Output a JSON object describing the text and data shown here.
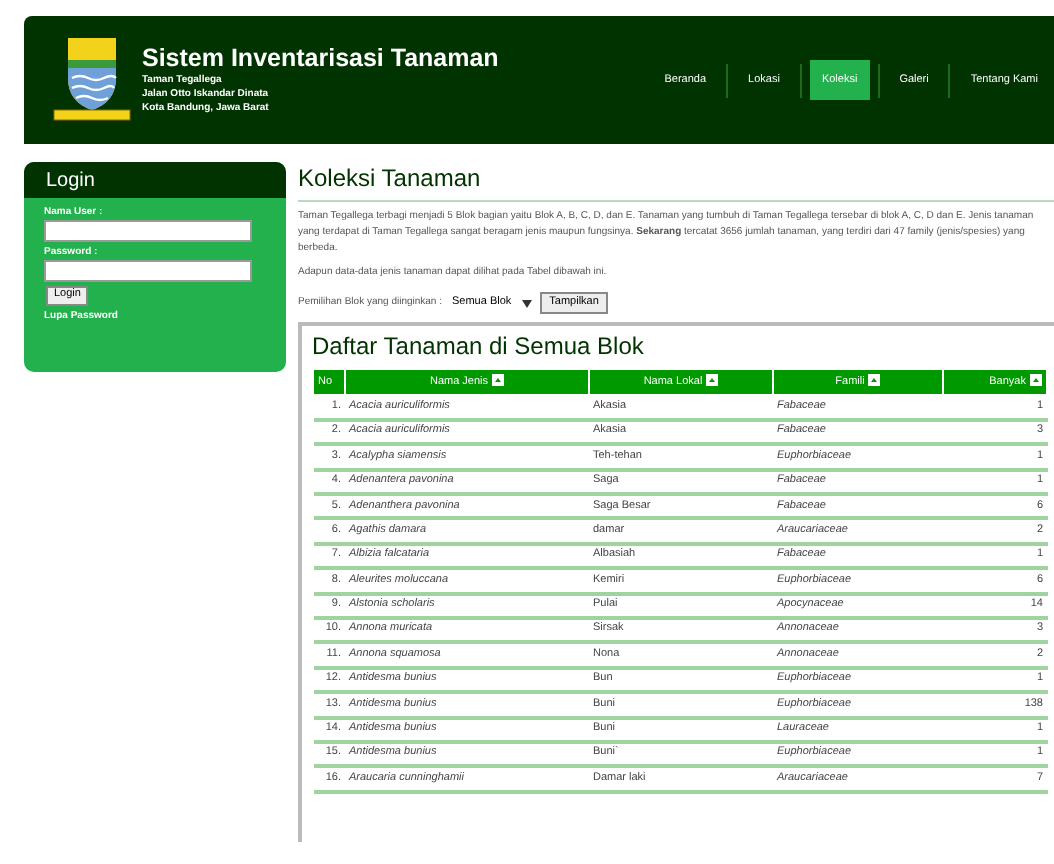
{
  "header": {
    "title": "Sistem Inventarisasi Tanaman",
    "address": [
      "Taman Tegallega",
      "Jalan Otto Iskandar Dinata",
      "Kota Bandung, Jawa Barat"
    ]
  },
  "nav": [
    {
      "label": "Beranda",
      "selected": false
    },
    {
      "label": "Lokasi",
      "selected": false
    },
    {
      "label": "Koleksi",
      "selected": true
    },
    {
      "label": "Galeri",
      "selected": false
    },
    {
      "label": "Tentang Kami",
      "selected": false
    }
  ],
  "login": {
    "title": "Login",
    "username_label": "Nama User :",
    "password_label": "Password :",
    "button": "Login",
    "forgot_link": "Lupa Password"
  },
  "content": {
    "title": "Koleksi Tanaman",
    "paragraph": "Taman Tegallega terbagi menjadi 5 Blok bagian yaitu Blok A, B, C, D, dan E. Tanaman yang tumbuh di Taman Tegallega tersebar di blok A, C, D dan E. Jenis tanaman yang terdapat di Taman Tegallega sangat beragam jenis maupun fungsinya. **Sekarang** tercatat 3656 jumlah tanaman, yang terdiri dari 47 family (jenis/spesies) yang berbeda.",
    "note": "Adapun data-data jenis tanaman dapat dilihat pada Tabel dibawah ini.",
    "filter_label": "Pemilihan Blok yang diinginkan :",
    "filter_value": "Semua Blok",
    "filter_button": "Tampilkan"
  },
  "table": {
    "title": "Daftar Tanaman di Semua Blok",
    "columns": [
      {
        "label": "No",
        "sortable": false
      },
      {
        "label": "Nama Jenis",
        "sortable": true
      },
      {
        "label": "Nama Lokal",
        "sortable": true
      },
      {
        "label": "Famili",
        "sortable": true
      },
      {
        "label": "Banyak",
        "sortable": true
      }
    ],
    "rows": [
      [
        "1.",
        "Acacia auriculiformis",
        "Akasia",
        "Fabaceae",
        "1"
      ],
      [
        "2.",
        "Acacia auriculiformis",
        "Akasia",
        "Fabaceae",
        "3"
      ],
      [
        "3.",
        "Acalypha siamensis",
        "Teh-tehan",
        "Euphorbiaceae",
        "1"
      ],
      [
        "4.",
        "Adenantera pavonina",
        "Saga",
        "Fabaceae",
        "1"
      ],
      [
        "5.",
        "Adenanthera pavonina",
        "Saga Besar",
        "Fabaceae",
        "6"
      ],
      [
        "6.",
        "Agathis damara",
        "damar",
        "Araucariaceae",
        "2"
      ],
      [
        "7.",
        "Albizia falcataria",
        "Albasiah",
        "Fabaceae",
        "1"
      ],
      [
        "8.",
        "Aleurites moluccana",
        "Kemiri",
        "Euphorbiaceae",
        "6"
      ],
      [
        "9.",
        "Alstonia scholaris",
        "Pulai",
        "Apocynaceae",
        "14"
      ],
      [
        "10.",
        "Annona muricata",
        "Sirsak",
        "Annonaceae",
        "3"
      ],
      [
        "11.",
        "Annona squamosa",
        "Nona",
        "Annonaceae",
        "2"
      ],
      [
        "12.",
        "Antidesma bunius",
        "Bun",
        "Euphorbiaceae",
        "1"
      ],
      [
        "13.",
        "Antidesma bunius",
        "Buni",
        "Euphorbiaceae",
        "138"
      ],
      [
        "14.",
        "Antidesma bunius",
        "Buni",
        "Lauraceae",
        "1"
      ],
      [
        "15.",
        "Antidesma bunius",
        "Buni`",
        "Euphorbiaceae",
        "1"
      ],
      [
        "16.",
        "Araucaria cunninghamii",
        "Damar laki",
        "Araucariaceae",
        "7"
      ]
    ]
  }
}
